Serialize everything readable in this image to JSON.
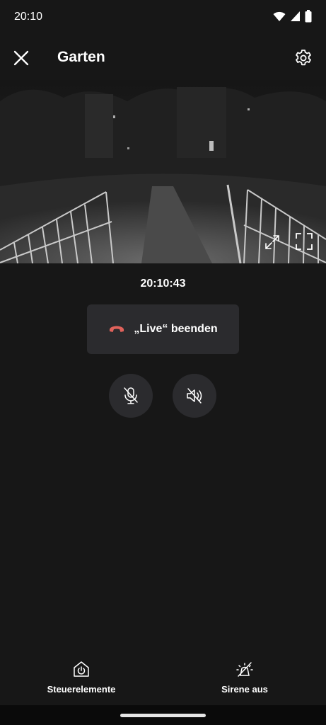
{
  "status_bar": {
    "time": "20:10",
    "icons": [
      "wifi-icon",
      "signal-icon",
      "battery-icon"
    ]
  },
  "header": {
    "title": "Garten",
    "close_icon": "close-icon",
    "settings_icon": "gear-icon"
  },
  "video": {
    "expand_icon": "expand-icon",
    "fullscreen_icon": "fullscreen-icon"
  },
  "timestamp": "20:10:43",
  "end_live": {
    "label": "„Live“ beenden",
    "icon": "hang-up-icon",
    "icon_color": "#e0625b"
  },
  "audio_controls": {
    "mic_icon": "mic-muted-icon",
    "speaker_icon": "speaker-muted-icon"
  },
  "bottom_bar": {
    "controls_label": "Steuerelemente",
    "siren_label": "Sirene aus"
  },
  "colors": {
    "background": "#171717",
    "button_bg": "#2b2b2e",
    "accent_red": "#e0625b"
  }
}
